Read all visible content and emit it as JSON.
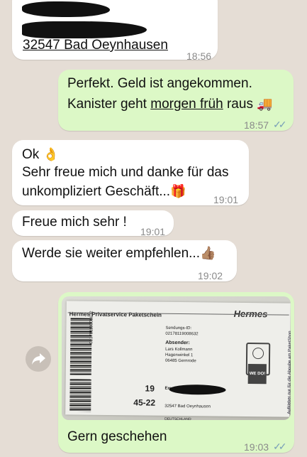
{
  "messages": {
    "m1": {
      "line3": "32547 Bad Oeynhausen",
      "time": "18:56"
    },
    "m2": {
      "line1": "Perfekt. Geld ist angekommen.",
      "line2a": "Kanister geht ",
      "line2b": "morgen früh",
      "line2c": " raus",
      "emoji": "🚚",
      "time": "18:57"
    },
    "m3": {
      "line1": "Ok",
      "emoji1": "👌",
      "line2": "Sehr freue mich und danke für das",
      "line3": "unkompliziert Geschäft...",
      "emoji2": "🎁",
      "time": "19:01"
    },
    "m4": {
      "text": "Freue mich sehr !",
      "time": "19:01"
    },
    "m5": {
      "text": "Werde sie weiter empfehlen...",
      "emoji": "👍🏽",
      "time": "19:02"
    },
    "m6": {
      "caption": "Gern geschehen",
      "time": "19:03",
      "photo": {
        "heading": "Hermes Privatservice Paketschein",
        "brand": "Hermes",
        "sendungs_label": "Sendungs-ID:",
        "sendungs_id": "02178119008632",
        "absender_label": "Absender:",
        "absender_name": "Lars Kollmann",
        "absender_street": "Hagenwinkel 1",
        "absender_city": "06485 Gernrode",
        "vertical_code": "02178119008632",
        "code1": "19",
        "code2": "45-22",
        "empfaenger_label": "Empfänger:",
        "empfaenger_city": "32547 Bad Oeynhausen",
        "country": "DEUTSCHLAND",
        "logo_text": "WE DO!",
        "side_text": "Aufkleber nur für die Abgabe am PaketShop"
      }
    }
  },
  "colors": {
    "incoming": "#ffffff",
    "outgoing": "#dcf8c6",
    "background": "#e5ddd5",
    "read_ticks": "#7aa0b8"
  },
  "icons": {
    "forward": "share-forward-icon",
    "ticks": "double-check-icon"
  }
}
